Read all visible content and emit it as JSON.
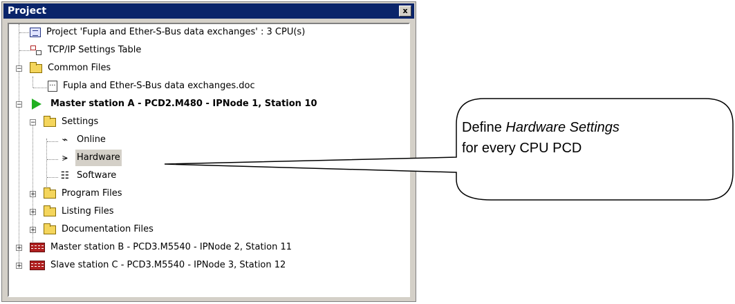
{
  "panel": {
    "title": "Project",
    "close_label": "x"
  },
  "tree": {
    "project": "Project 'Fupla and Ether-S-Bus data exchanges' : 3 CPU(s)",
    "tcpip": "TCP/IP Settings Table",
    "common_files": "Common Files",
    "common_doc": "Fupla and Ether-S-Bus data exchanges.doc",
    "master_a": "Master station A - PCD2.M480 - IPNode 1, Station 10",
    "settings": "Settings",
    "online": "Online",
    "hardware": "Hardware",
    "software": "Software",
    "program_files": "Program Files",
    "listing_files": "Listing Files",
    "documentation_files": "Documentation Files",
    "master_b": "Master station B - PCD3.M5540 - IPNode 2, Station 11",
    "slave_c": "Slave station C - PCD3.M5540 - IPNode 3, Station 12"
  },
  "callout": {
    "text_before": "Define ",
    "text_italic": "Hardware Settings",
    "text_after": " for every CPU PCD"
  },
  "expanders": {
    "minus": "−",
    "plus": "+"
  }
}
